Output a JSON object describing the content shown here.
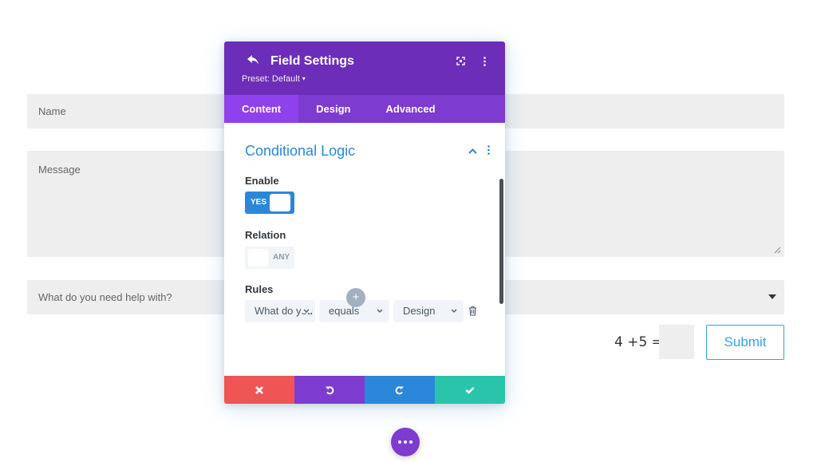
{
  "form": {
    "name_placeholder": "Name",
    "message_placeholder": "Message",
    "help_select_placeholder": "What do you need help with?",
    "captcha_label": "4 +5 =",
    "submit_label": "Submit"
  },
  "modal": {
    "title": "Field Settings",
    "preset": "Preset: Default",
    "tabs": [
      {
        "label": "Content",
        "active": true
      },
      {
        "label": "Design",
        "active": false
      },
      {
        "label": "Advanced",
        "active": false
      }
    ],
    "section_title": "Conditional Logic",
    "enable_label": "Enable",
    "enable_value": "YES",
    "relation_label": "Relation",
    "relation_value": "ANY",
    "rules_label": "Rules",
    "rule": {
      "field": "What do you need help with?",
      "operator": "equals",
      "value": "Design"
    },
    "add_rule_symbol": "+"
  },
  "colors": {
    "header": "#6c2eb9",
    "tabs": "#7d3bcf",
    "active_tab": "#8f42ec",
    "accent_blue": "#2b87da",
    "cancel": "#ef5555",
    "undo": "#7e3bd0",
    "redo": "#2b87da",
    "save": "#29c4a9"
  },
  "icons": {
    "back": "back-arrow-icon",
    "focus": "focus-mode-icon",
    "more": "vertical-dots-icon",
    "collapse": "chevron-up-icon",
    "trash": "trash-icon",
    "cancel": "close-icon",
    "undo": "undo-icon",
    "redo": "redo-icon",
    "save": "checkmark-icon",
    "fab": "horizontal-dots-icon"
  }
}
